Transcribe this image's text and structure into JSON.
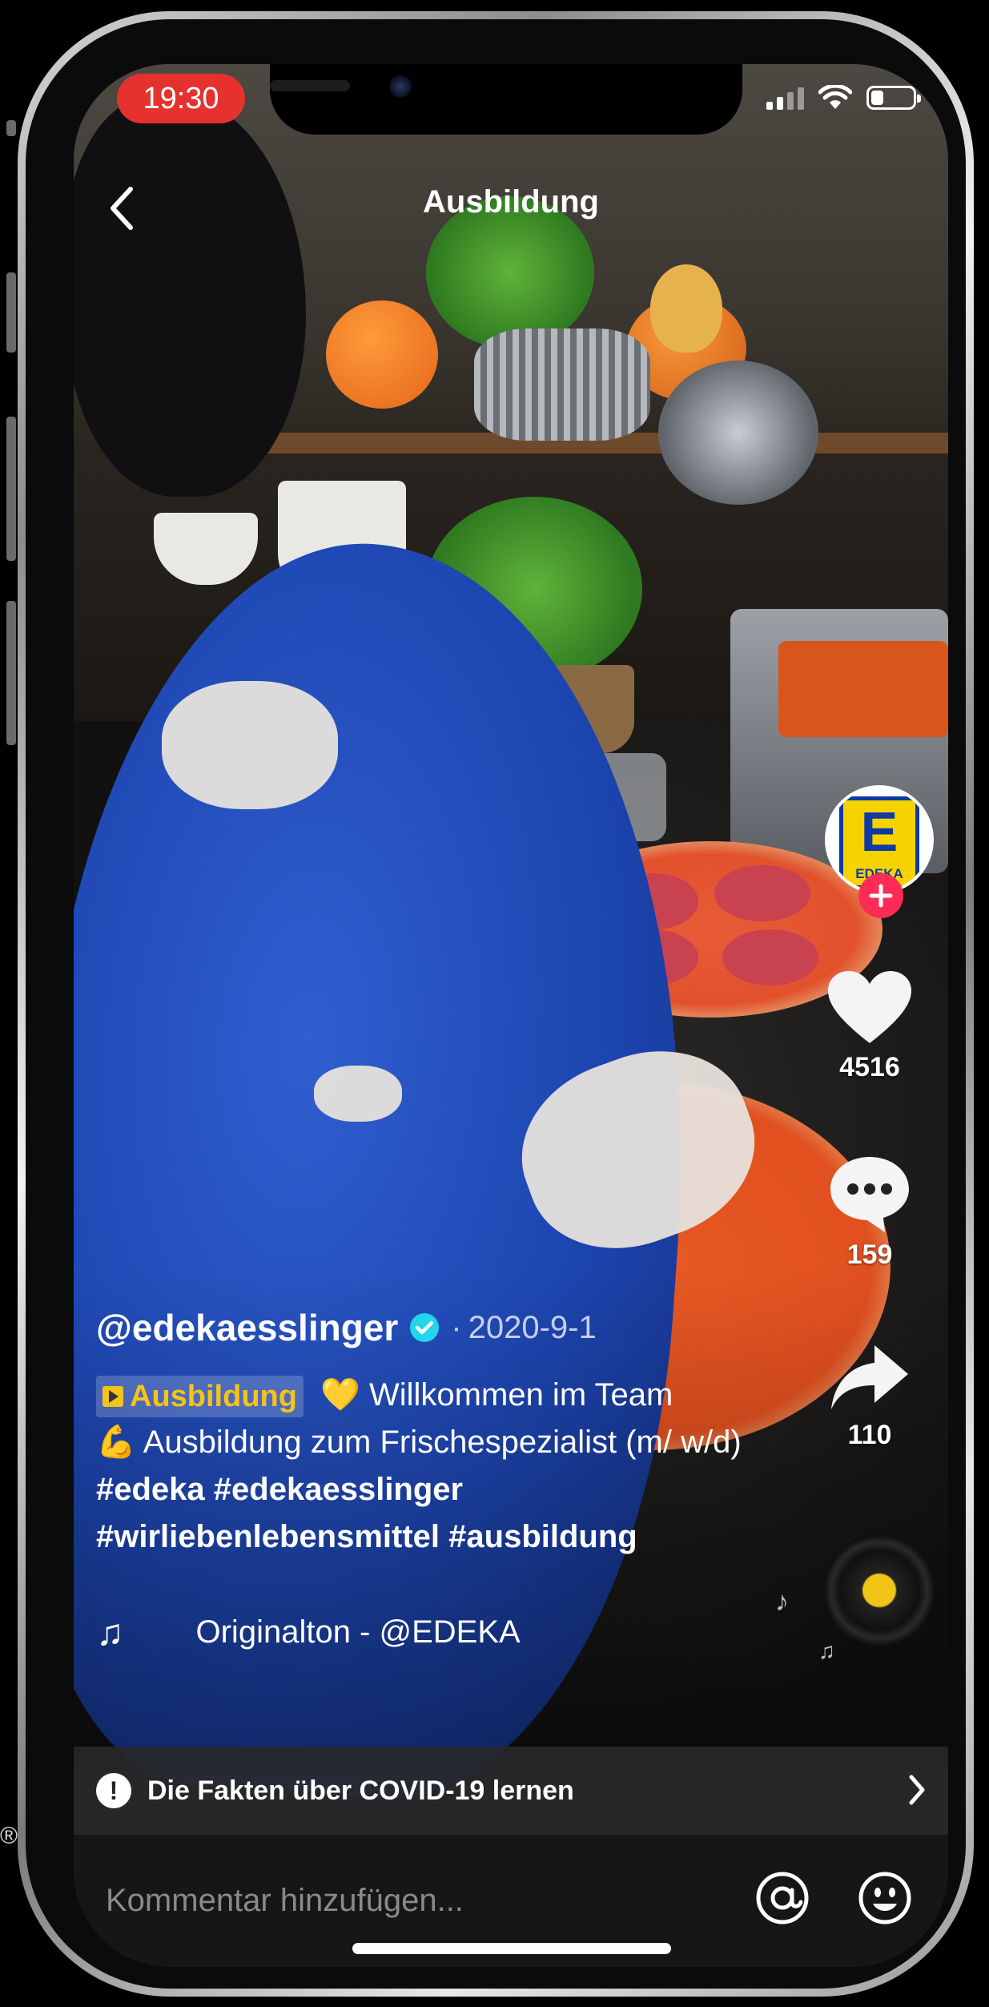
{
  "status_bar": {
    "time": "19:30",
    "battery_level": 0.3,
    "signal_bars": 2
  },
  "header": {
    "title": "Ausbildung"
  },
  "creator": {
    "username": "@edekaesslinger",
    "date_prefix": "·",
    "date": "2020-9-1",
    "avatar_word": "EDEKA",
    "avatar_letter": "E"
  },
  "rail": {
    "likes": "4516",
    "comments": "159",
    "shares": "110"
  },
  "caption": {
    "chip_label": "Ausbildung",
    "emoji_heart": "💛",
    "text_1": " Willkommen im Team",
    "emoji_muscle": "💪",
    "text_2": " Ausbildung zum Frischespezialist (m/ w/d) ",
    "hashtags": [
      "#edeka",
      "#edekaesslinger",
      "#wirliebenlebensmittel",
      "#ausbildung"
    ]
  },
  "sound": {
    "label": "Originalton - @EDEKA"
  },
  "covid_banner": {
    "text": "Die Fakten über COVID-19 lernen"
  },
  "comment": {
    "placeholder": "Kommentar hinzufügen..."
  },
  "colors": {
    "accent": "#fe2c55",
    "time_pill": "#e5322f",
    "chip": "#f7c21a",
    "verified": "#20d5ec"
  },
  "icons": [
    "back-arrow-icon",
    "heart-icon",
    "comment-bubble-icon",
    "share-arrow-icon",
    "music-note-icon",
    "alert-icon",
    "chevron-right-icon",
    "at-icon",
    "emoji-icon",
    "verified-icon",
    "plus-icon"
  ]
}
